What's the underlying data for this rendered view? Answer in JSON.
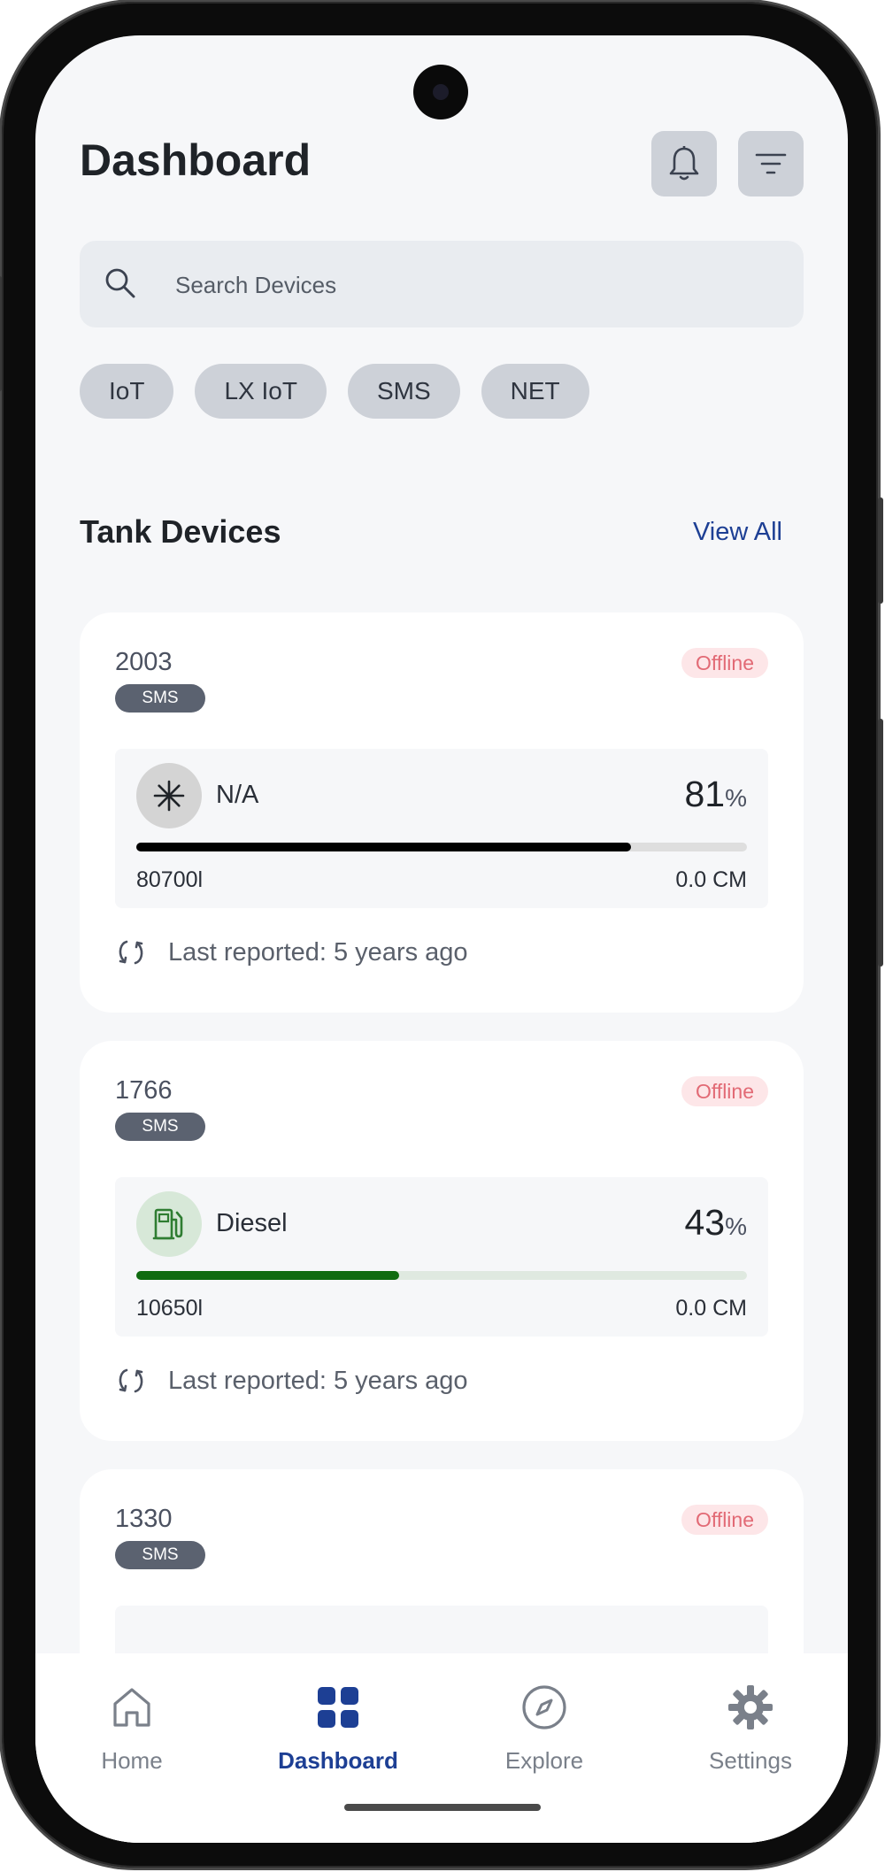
{
  "header": {
    "title": "Dashboard"
  },
  "search": {
    "placeholder": "Search Devices"
  },
  "filters": [
    "IoT",
    "LX IoT",
    "SMS",
    "NET"
  ],
  "section": {
    "title": "Tank Devices",
    "view_all": "View All"
  },
  "devices": [
    {
      "id": "2003",
      "type": "SMS",
      "status": "Offline",
      "fuel": "N/A",
      "fuel_icon": "asterisk-icon",
      "percent": "81",
      "percent_unit": "%",
      "fill_fraction": 0.81,
      "capacity": "80700l",
      "level": "0.0 CM",
      "last_reported": "Last reported: 5 years ago",
      "bar_color": "#000000",
      "track_color": "#dedede",
      "icon_bg": "#d4d4d4"
    },
    {
      "id": "1766",
      "type": "SMS",
      "status": "Offline",
      "fuel": "Diesel",
      "fuel_icon": "fuel-pump-icon",
      "percent": "43",
      "percent_unit": "%",
      "fill_fraction": 0.43,
      "capacity": "10650l",
      "level": "0.0 CM",
      "last_reported": "Last reported: 5 years ago",
      "bar_color": "#0f6b10",
      "track_color": "#dfe9e0",
      "icon_bg": "#d7e8d8"
    },
    {
      "id": "1330",
      "type": "SMS",
      "status": "Offline"
    }
  ],
  "nav": [
    {
      "label": "Home",
      "icon": "home-icon",
      "active": false
    },
    {
      "label": "Dashboard",
      "icon": "dashboard-grid-icon",
      "active": true
    },
    {
      "label": "Explore",
      "icon": "compass-icon",
      "active": false
    },
    {
      "label": "Settings",
      "icon": "gear-icon",
      "active": false
    }
  ],
  "colors": {
    "accent": "#1d3f94",
    "offline_text": "#e26a75",
    "offline_bg": "#fde6e8"
  }
}
